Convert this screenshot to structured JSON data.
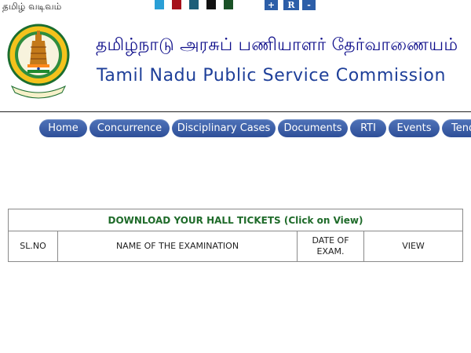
{
  "top": {
    "language_link": "தமிழ் வடிவம்",
    "theme_colors": [
      "#2a9fd6",
      "#a6111b",
      "#1c5e79",
      "#111111",
      "#1a5227"
    ],
    "font_controls": [
      "+",
      "R",
      "-"
    ]
  },
  "header": {
    "logo": "tamil-nadu-government-seal",
    "title_tamil": "தமிழ்நாடு அரசுப் பணியாளர் தேர்வாணையம்",
    "title_english": "Tamil Nadu Public Service Commission"
  },
  "nav": {
    "items": [
      "Home",
      "Concurrence",
      "Disciplinary Cases",
      "Documents",
      "RTI",
      "Events",
      "Tend"
    ]
  },
  "tickets_table": {
    "caption": "DOWNLOAD YOUR HALL TICKETS (Click on View)",
    "columns": [
      "SL.NO",
      "NAME OF THE EXAMINATION",
      "DATE OF\nEXAM.",
      "VIEW"
    ]
  }
}
